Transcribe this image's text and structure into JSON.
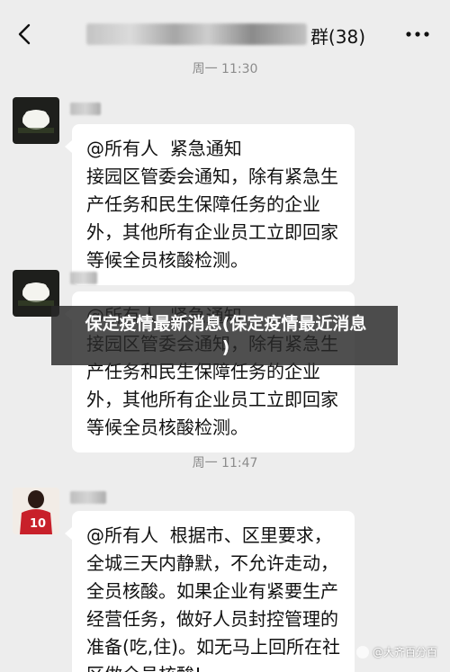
{
  "header": {
    "title": "群(38)",
    "back_icon": "chevron-left-icon",
    "more_icon": "more-dots-icon"
  },
  "timestamps": [
    "周一 11:30",
    "周一 11:47"
  ],
  "messages": [
    {
      "avatar_icon": "white-flower-avatar-icon",
      "text": "@所有人  紧急通知\n接园区管委会通知，除有紧急生产任务和民生保障任务的企业外，其他所有企业员工立即回家等候全员核酸检测。"
    },
    {
      "avatar_icon": "white-flower-avatar-icon",
      "text": "@所有人  紧急通知\n接园区管委会通知，除有紧急生产任务和民生保障任务的企业外，其他所有企业员工立即回家等候全员核酸检测。"
    },
    {
      "avatar_icon": "basketball-player-avatar-icon",
      "text": "@所有人  根据市、区里要求，全城三天内静默，不允许走动，全员核酸。如果企业有紧要生产经营任务，做好人员封控管理的准备(吃,住)。如无马上回所在社区做全员核酸!"
    }
  ],
  "overlay": {
    "line1": "保定疫情最新消息(保定疫情最近消息",
    "line2": ")"
  },
  "watermark": "@大齐百分百",
  "colors": {
    "background": "#ededed",
    "bubble": "#ffffff",
    "timestamp": "#8c8c8c",
    "overlay": "#282828"
  }
}
